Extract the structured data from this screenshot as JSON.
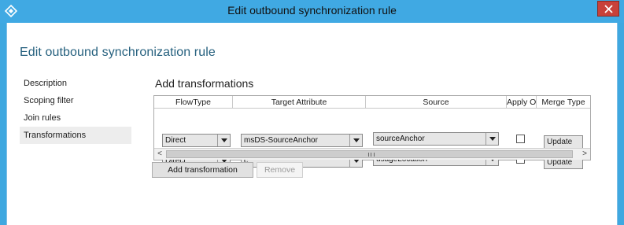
{
  "window": {
    "title": "Edit outbound synchronization rule",
    "app_icon": "azure-ad-connect-icon",
    "close_icon": "close-icon",
    "titlebar_color": "#40a9e3",
    "close_color": "#c8413a"
  },
  "page": {
    "heading": "Edit outbound synchronization rule",
    "heading_color": "#25607e"
  },
  "nav": {
    "items": [
      {
        "label": "Description"
      },
      {
        "label": "Scoping filter"
      },
      {
        "label": "Join rules"
      },
      {
        "label": "Transformations",
        "active": true
      }
    ]
  },
  "transformations": {
    "title": "Add transformations",
    "columns": [
      "FlowType",
      "Target Attribute",
      "Source",
      "Apply Or",
      "Merge Type"
    ],
    "rows": [
      {
        "flow_type": "Direct",
        "target_attribute": "msDS-SourceAnchor",
        "source": "sourceAnchor",
        "apply_once": false,
        "merge_type": "Update"
      },
      {
        "flow_type": "Direct",
        "target_attribute": "c",
        "source": "usageLocation",
        "apply_once": false,
        "merge_type": "Update"
      }
    ],
    "scroll_left": "<",
    "scroll_right": ">"
  },
  "buttons": {
    "add_label": "Add transformation",
    "remove_label": "Remove",
    "remove_enabled": false
  }
}
